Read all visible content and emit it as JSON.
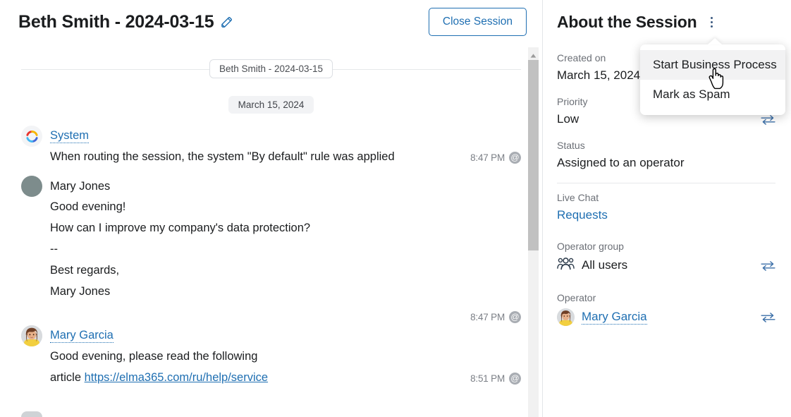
{
  "chat": {
    "title": "Beth Smith - 2024-03-15",
    "edit_icon": "pencil-icon",
    "close_button": "Close Session",
    "session_chip": "Beth Smith - 2024-03-15",
    "date_chip": "March 15, 2024",
    "messages": [
      {
        "author": "System",
        "author_is_link": true,
        "avatar": "system-logo-icon",
        "lines": [
          "When routing the session, the system \"By default\" rule was applied"
        ],
        "time": "8:47 PM",
        "badge": "@"
      },
      {
        "author": "Mary Jones",
        "author_is_link": false,
        "avatar": "plain-avatar",
        "lines": [
          "Good evening!",
          "How can I improve my company's data protection?",
          "--",
          "Best regards,",
          "Mary Jones"
        ],
        "time": "8:47 PM",
        "badge": "@"
      },
      {
        "author": "Mary Garcia",
        "author_is_link": true,
        "avatar": "photo-avatar",
        "lines": [
          "Good evening, please read the following",
          "article "
        ],
        "link_text": "https://elma365.com/ru/help/service",
        "time": "8:51 PM",
        "badge": "@"
      }
    ]
  },
  "about": {
    "title": "About the Session",
    "menu_icon": "kebab-menu-icon",
    "fields": [
      {
        "label": "Created on",
        "value": "March 15, 2024",
        "swap": false,
        "link": false
      },
      {
        "label": "Priority",
        "value": "Low",
        "swap": true,
        "link": false
      },
      {
        "label": "Status",
        "value": "Assigned to an operator",
        "swap": false,
        "link": false
      },
      {
        "label": "Live Chat",
        "value": "Requests",
        "swap": false,
        "link": true
      },
      {
        "label": "Operator group",
        "value": "All users",
        "swap": true,
        "link": false,
        "icon": "group-users-icon"
      },
      {
        "label": "Operator",
        "value": "Mary Garcia",
        "swap": true,
        "link": true,
        "icon": "avatar-photo"
      }
    ]
  },
  "dropdown": {
    "items": [
      {
        "label": "Start Business Process",
        "hovered": true
      },
      {
        "label": "Mark as Spam",
        "hovered": false
      }
    ]
  },
  "colors": {
    "accent": "#1f6fb2",
    "text": "#1b1d1f",
    "muted": "#6b6f76",
    "border": "#e6e8ea",
    "hover_bg": "#f2f2f3"
  }
}
